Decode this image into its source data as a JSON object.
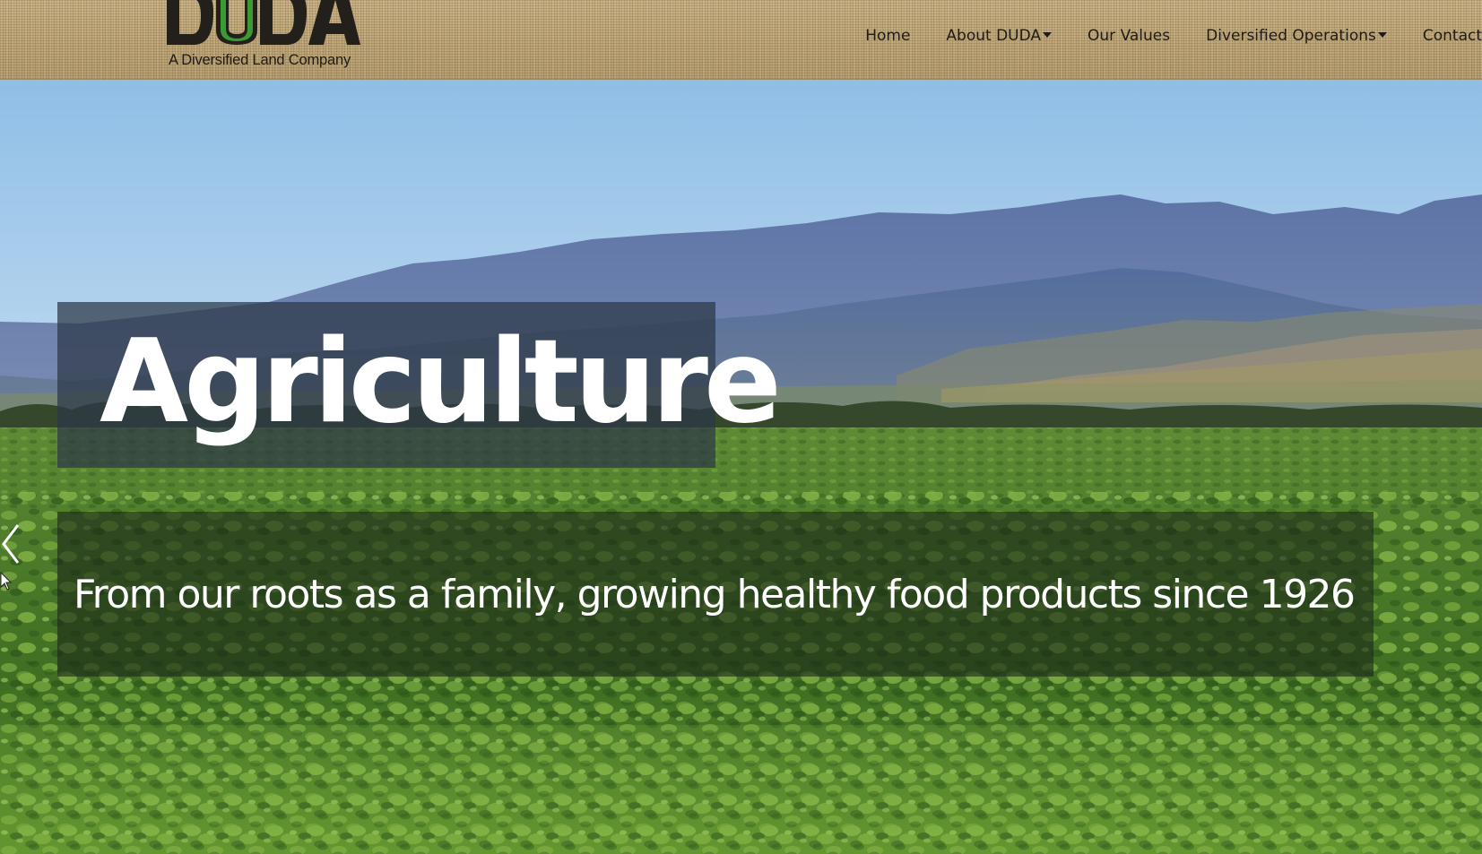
{
  "logo": {
    "wordmark": "DUDA",
    "registered": "®",
    "tagline": "A Diversified Land Company"
  },
  "nav": {
    "items": [
      {
        "label": "Home",
        "dropdown": false
      },
      {
        "label": "About DUDA",
        "dropdown": true
      },
      {
        "label": "Our Values",
        "dropdown": false
      },
      {
        "label": "Diversified Operations",
        "dropdown": true
      },
      {
        "label": "Contact",
        "dropdown": false
      }
    ]
  },
  "hero": {
    "title": "Agriculture",
    "tagline": "From our roots as a family, growing healthy food products since 1926",
    "prev_icon": "chevron-left-icon"
  },
  "colors": {
    "logo_dark": "#231f1a",
    "logo_green": "#3a9a35",
    "nav_text": "#1f1b15"
  }
}
